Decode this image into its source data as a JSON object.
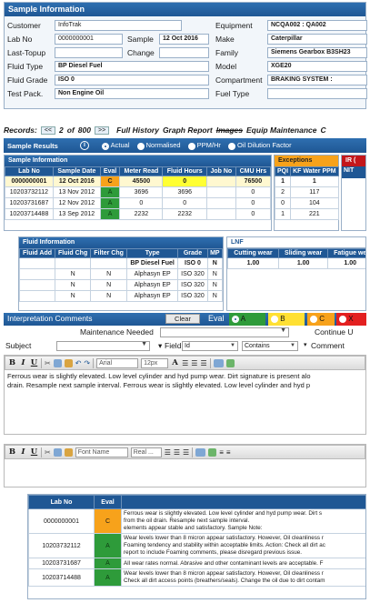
{
  "sample_info": {
    "title": "Sample Information",
    "customer_label": "Customer",
    "customer": "InfoTrak",
    "lab_no_label": "Lab No",
    "lab_no": "0000000001",
    "sample_label": "Sample",
    "sample": "12 Oct 2016",
    "last_topup_label": "Last-Topup",
    "last_topup": "",
    "change_label": "Change",
    "change": "",
    "fluid_type_label": "Fluid Type",
    "fluid_type": "BP Diesel Fuel",
    "fluid_grade_label": "Fluid Grade",
    "fluid_grade": "ISO 0",
    "test_pack_label": "Test Pack.",
    "test_pack": "Non Engine Oil",
    "equipment_label": "Equipment",
    "equipment": "NCQA002 : QA002",
    "make_label": "Make",
    "make": "Caterpillar",
    "family_label": "Family",
    "family": "Siemens Gearbox B3SH23",
    "model_label": "Model",
    "model": "XGE20",
    "compartment_label": "Compartment",
    "compartment": "BRAKING SYSTEM :",
    "fuel_type_label": "Fuel Type",
    "fuel_type": ""
  },
  "records_bar": {
    "records_label": "Records:",
    "prev": "<<",
    "current": "2",
    "of_label": "of",
    "total": "800",
    "next": ">>",
    "full_history": "Full History",
    "graph_report": "Graph Report",
    "images": "Images",
    "equip_maintenance": "Equip Maintenance",
    "trailing": "C"
  },
  "sample_results": {
    "title": "Sample Results",
    "info_icon": "i",
    "options": [
      "Actual",
      "Normalised",
      "PPM/Hr",
      "Oil Dilution Factor"
    ],
    "selected": "Actual"
  },
  "sample_table": {
    "title": "Sample Information",
    "columns": [
      "Lab No",
      "Sample Date",
      "Eval",
      "Meter Read",
      "Fluid Hours",
      "Job No",
      "CMU Hrs"
    ],
    "rows": [
      {
        "lab_no": "0000000001",
        "date": "12 Oct 2016",
        "eval": "C",
        "meter": "45500",
        "fluid_hours": "0",
        "job": "",
        "cmu": "76500"
      },
      {
        "lab_no": "10203732112",
        "date": "13 Nov 2012",
        "eval": "A",
        "meter": "3696",
        "fluid_hours": "3696",
        "job": "",
        "cmu": "0"
      },
      {
        "lab_no": "10203731687",
        "date": "12 Nov 2012",
        "eval": "A",
        "meter": "0",
        "fluid_hours": "0",
        "job": "",
        "cmu": "0"
      },
      {
        "lab_no": "10203714488",
        "date": "13 Sep 2012",
        "eval": "A",
        "meter": "2232",
        "fluid_hours": "2232",
        "job": "",
        "cmu": "0"
      }
    ]
  },
  "exceptions": {
    "title": "Exceptions",
    "columns": [
      "PQI",
      "KF Water PPM"
    ],
    "rows": [
      [
        "1",
        "1"
      ],
      [
        "2",
        "117"
      ],
      [
        "0",
        "104"
      ],
      [
        "1",
        "221"
      ]
    ]
  },
  "ir_panel": {
    "title": "IR (",
    "column": "NIT"
  },
  "fluid_info": {
    "title": "Fluid Information",
    "columns": [
      "Fluid Add",
      "Fluid Chg",
      "Filter Chg",
      "Type",
      "Grade",
      "MP"
    ],
    "rows": [
      [
        "",
        "",
        "",
        "BP Diesel Fuel",
        "ISO 0",
        "N"
      ],
      [
        "",
        "N",
        "N",
        "Alphasyn EP",
        "ISO 320",
        "N"
      ],
      [
        "",
        "N",
        "N",
        "Alphasyn EP",
        "ISO 320",
        "N"
      ],
      [
        "",
        "N",
        "N",
        "Alphasyn EP",
        "ISO 320",
        "N"
      ]
    ]
  },
  "lnf": {
    "title": "LNF",
    "columns": [
      "Cutting wear",
      "Sliding wear",
      "Fatigue we"
    ],
    "rows": [
      [
        "1.00",
        "1.00",
        "1.00"
      ]
    ]
  },
  "interpretation": {
    "title": "Interpretation Comments",
    "clear_label": "Clear",
    "eval_label": "Eval",
    "eval_options": [
      {
        "code": "A",
        "color": "#2e9b3a"
      },
      {
        "code": "B",
        "color": "#ffe033"
      },
      {
        "code": "C",
        "color": "#f7a21b"
      },
      {
        "code": "X",
        "color": "#e32020"
      }
    ],
    "maintenance_label": "Maintenance Needed",
    "continue_label": "Continue U",
    "subject_label": "Subject",
    "field_label": "Field",
    "field_value": "Id",
    "operator_value": "Contains",
    "comment_label": "Comment",
    "font_value": "Arial",
    "size_value": "12px",
    "editor_text_1": "Ferrous wear is slightly elevated.  Low level cylinder and hyd pump wear. Dirt signature is present alo",
    "editor_text_2": "drain.  Resample next sample interval. Ferrous wear is slightly elevated. Low level cylinder and hyd p",
    "font_name_value": "Font Name",
    "real_value": "Real ..."
  },
  "history": {
    "columns": [
      "Lab No",
      "Eval"
    ],
    "rows": [
      {
        "lab_no": "0000000001",
        "eval": "C",
        "comment": [
          "Ferrous wear is slightly elevated.  Low level cylinder and hyd pump wear.  Dirt s",
          "from the oil drain.  Resample next sample interval.",
          "elements appear stable and satisfactory.     Sample Note:"
        ]
      },
      {
        "lab_no": "10203732112",
        "eval": "A",
        "comment": [
          "Wear levels lower than 8 micron appear satisfactory. However, Oil cleanliness r",
          "Foaming tendency and stability within acceptable limits. Action: Check all dirt ac",
          "report to include Foaming comments, please disregard previous issue."
        ]
      },
      {
        "lab_no": "10203731687",
        "eval": "A",
        "comment": [
          "All wear rates normal. Abrasive and other contaminant levels are acceptable. F"
        ]
      },
      {
        "lab_no": "10203714488",
        "eval": "A",
        "comment": [
          "Wear levels lower than 8 micron appear satisfactory. However, Oil cleanliness r",
          "Check all dirt access points (breathers/seals). Change the oil due to dirt contam"
        ]
      }
    ]
  }
}
